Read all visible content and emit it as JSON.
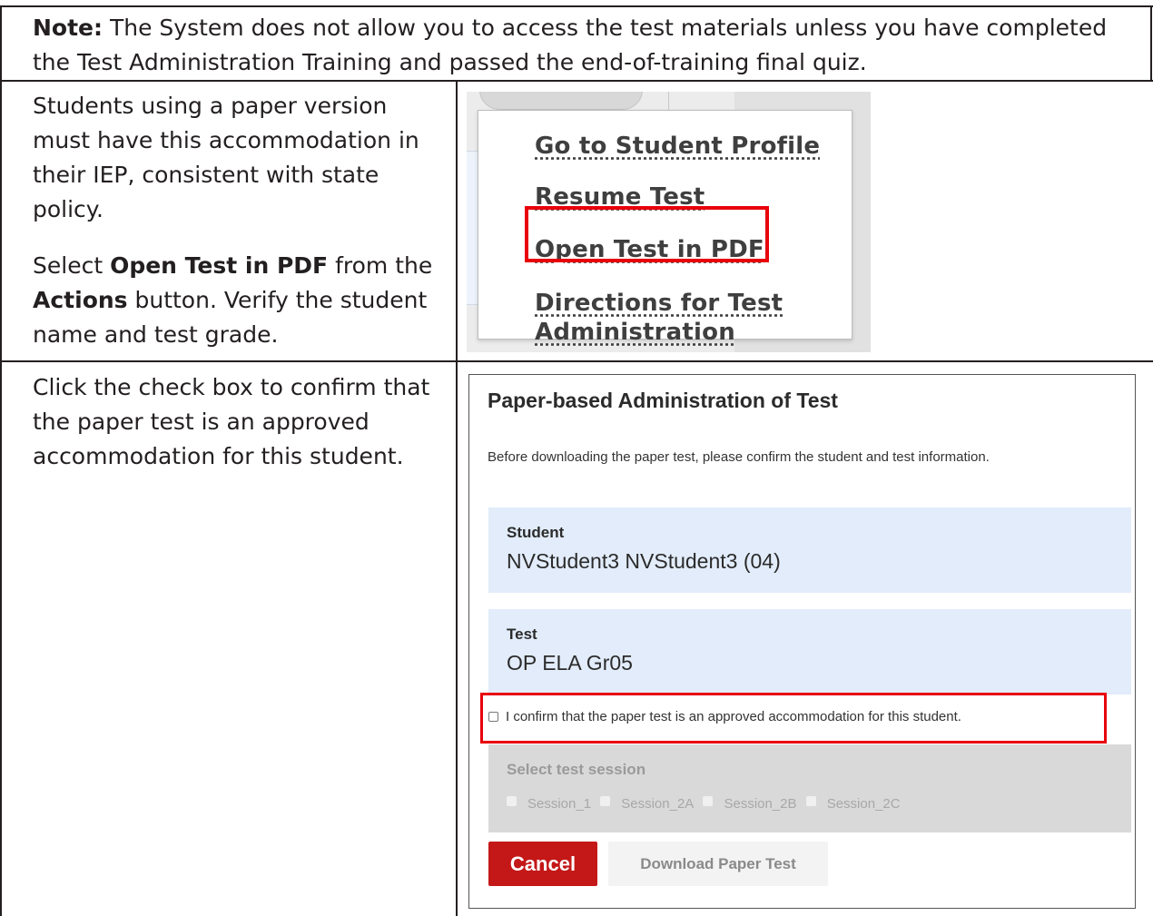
{
  "note": {
    "label": "Note:",
    "text": " The System does not allow you to access the test materials unless you have completed the Test Administration Training and passed the end-of-training final quiz."
  },
  "row1": {
    "para1": "Students using a paper version must have this accommodation in their IEP, consistent with state policy.",
    "para2_prefix": "Select ",
    "para2_bold1": "Open Test in PDF",
    "para2_mid": " from the ",
    "para2_bold2": "Actions",
    "para2_suffix": " button. Verify the student name and test grade."
  },
  "actions_menu": {
    "items": [
      "Go to Student Profile",
      "Resume Test",
      "Open Test in PDF",
      "Directions for Test Administration"
    ],
    "highlighted_index": 2
  },
  "row2": {
    "para1": "Click the check box to confirm that the paper test is an approved accommodation for this student."
  },
  "dialog": {
    "title": "Paper-based Administration of Test",
    "subtitle": "Before downloading the paper test, please confirm the student and test information.",
    "student_label": "Student",
    "student_value": "NVStudent3 NVStudent3 (04)",
    "test_label": "Test",
    "test_value": "OP ELA Gr05",
    "confirm_text": "I confirm that the paper test is an approved accommodation for this student.",
    "confirm_checked": false,
    "session_label": "Select test session",
    "sessions": [
      "Session_1",
      "Session_2A",
      "Session_2B",
      "Session_2C"
    ],
    "cancel_label": "Cancel",
    "download_label": "Download Paper Test"
  },
  "colors": {
    "highlight": "#e8000b",
    "cancel_button": "#c41818",
    "info_background": "#e2ecfa"
  }
}
